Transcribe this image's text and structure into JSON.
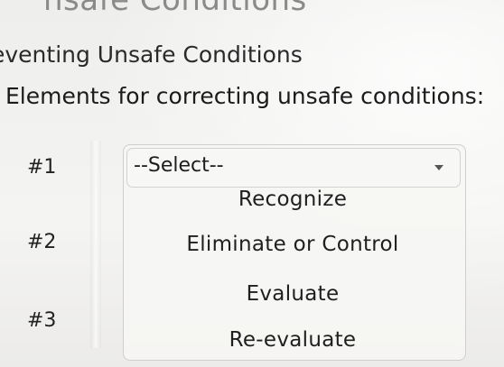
{
  "header": {
    "title": "nsafe Conditions",
    "subtitle": "eventing Unsafe Conditions"
  },
  "question": {
    "text": "Elements for correcting unsafe conditions:"
  },
  "rows": [
    {
      "label": "#1"
    },
    {
      "label": "#2"
    },
    {
      "label": "#3"
    }
  ],
  "dropdown": {
    "selected": "--Select--",
    "icon": "chevron-down-icon",
    "options": [
      "Recognize",
      "Eliminate or Control",
      "Evaluate",
      "Re-evaluate"
    ]
  },
  "colors": {
    "background": "#f2f2f0",
    "title_text": "#8a8a8a",
    "body_text": "#1e1e1e",
    "border": "#cfcfcf"
  }
}
